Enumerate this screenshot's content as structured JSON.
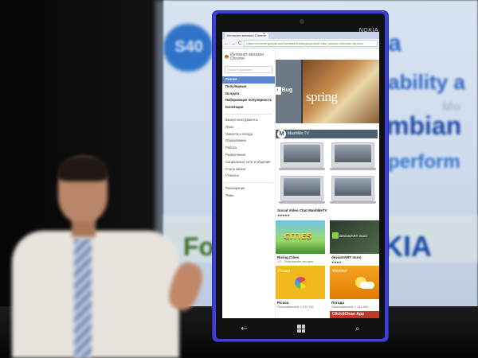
{
  "slide": {
    "badge": "S40",
    "word_a": "a",
    "word_ability": "ability a",
    "word_mo": "Mo",
    "word_mbian": "mbian",
    "word_perform": "perform",
    "word_fo": "Fo",
    "word_kia": "KIA"
  },
  "phone": {
    "brand": "NOKIA",
    "keys": {
      "back": "←",
      "search": "⌕"
    }
  },
  "browser": {
    "tab_title": "Интернет-магазин Chrome",
    "tab_close": "×",
    "nav_back": "←",
    "nav_forward": "→",
    "nav_reload": "C",
    "url": "https://chrome.google.com/webstore/category/home?utm_source=chrome-ntp-icon"
  },
  "store": {
    "title_line1": "Интернет-магазин",
    "title_line2": "Chrome",
    "search_placeholder": "Поиск в магазине",
    "categories_top": [
      "Разное",
      "Популярные",
      "Из круга",
      "Набирающие популярность",
      "Коллекции"
    ],
    "categories": [
      "Бизнес-инструменты",
      "Игры",
      "Новости и погода",
      "Образование",
      "Работа",
      "Развлечения",
      "Социальные сети и общение",
      "Стиль жизни",
      "Утилиты"
    ],
    "categories_bottom": [
      "Расширения",
      "Темы"
    ]
  },
  "content": {
    "hero_left_label": "erBug",
    "hero_title": "spring",
    "hero_prev": "‹",
    "mashme_logo": "M",
    "mashme_title": "MashMe.TV",
    "mashme_app_name": "Social Video Chat MashMeTV",
    "mashme_stars": "★★★★★",
    "rising_title": "CITIES",
    "rising_name": "Rising Cities",
    "rising_sub": "3.0 · Популярное сегодня",
    "deviant_tile": "deviantART muro",
    "deviant_name": "deviantART muro",
    "deviant_stars": "★★★★",
    "picasa_tile": "Picasa",
    "picasa_name": "Picasa",
    "picasa_sub": "Пользователей: 1 070 761",
    "weather_tile": "Weather",
    "weather_name": "Погода",
    "weather_sub": "Пользователей: 1 131 999",
    "click_title": "Click&Clean App"
  }
}
